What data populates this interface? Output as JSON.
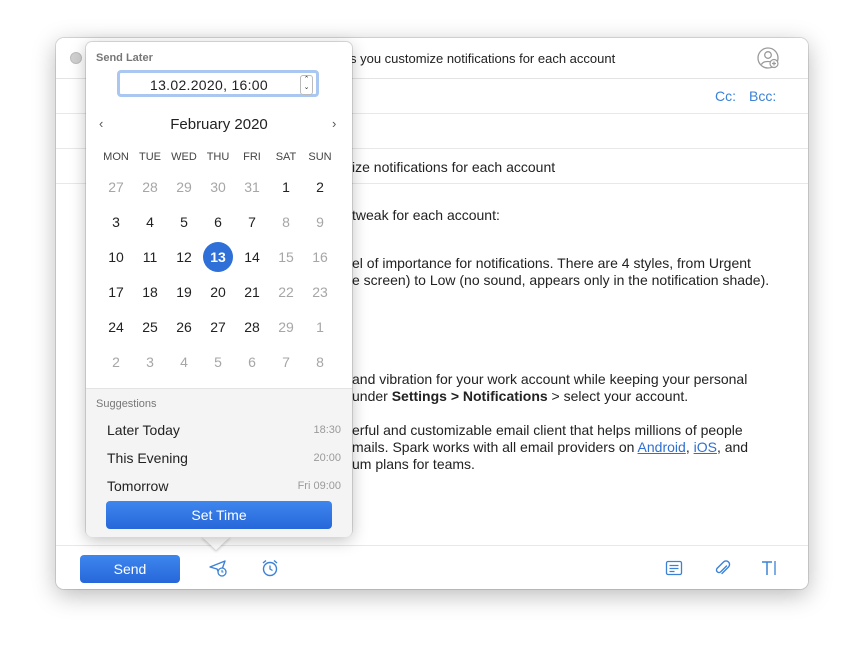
{
  "window": {
    "title": "s you customize notifications for each account",
    "cc_label": "Cc:",
    "bcc_label": "Bcc:",
    "from_fragment": ")",
    "subject": "ize notifications for each account"
  },
  "body": {
    "line1": "tweak for each account:",
    "line2": "el of importance for notifications. There are 4 styles, from Urgent",
    "line3": "e screen) to Low (no sound, appears only in the notification shade).",
    "line4": "and vibration for your work account while keeping your personal",
    "line5_pre": "under ",
    "line5_bold": "Settings > Notifications",
    "line5_post": " > select your account.",
    "line6": "erful and customizable email client that helps millions of people",
    "line7_pre": "mails. Spark works with all email providers on ",
    "link_android": "Android",
    "line7_sep": ", ",
    "link_ios": "iOS",
    "line7_post": ", and",
    "line8": "um plans for teams."
  },
  "popup": {
    "label": "Send Later",
    "datetime": "13.02.2020,  16:00",
    "month": "February 2020",
    "prev": "‹",
    "next": "›",
    "weekdays": [
      "MON",
      "TUE",
      "WED",
      "THU",
      "FRI",
      "SAT",
      "SUN"
    ],
    "weeks": [
      [
        "27",
        "28",
        "29",
        "30",
        "31",
        "1",
        "2"
      ],
      [
        "3",
        "4",
        "5",
        "6",
        "7",
        "8",
        "9"
      ],
      [
        "10",
        "11",
        "12",
        "13",
        "14",
        "15",
        "16"
      ],
      [
        "17",
        "18",
        "19",
        "20",
        "21",
        "22",
        "23"
      ],
      [
        "24",
        "25",
        "26",
        "27",
        "28",
        "29",
        "1"
      ],
      [
        "2",
        "3",
        "4",
        "5",
        "6",
        "7",
        "8"
      ]
    ],
    "selected_day": "13",
    "suggestions_label": "Suggestions",
    "suggestions": [
      {
        "label": "Later Today",
        "time": "18:30"
      },
      {
        "label": "This Evening",
        "time": "20:00"
      },
      {
        "label": "Tomorrow",
        "time": "Fri 09:00"
      }
    ],
    "set_time_label": "Set Time"
  },
  "footer": {
    "send_label": "Send",
    "icons": [
      "send-later-icon",
      "reminder-clock-icon",
      "template-icon",
      "attachment-icon",
      "text-format-icon"
    ]
  },
  "colors": {
    "accent": "#2f6fd8",
    "link": "#2f6fd1"
  }
}
